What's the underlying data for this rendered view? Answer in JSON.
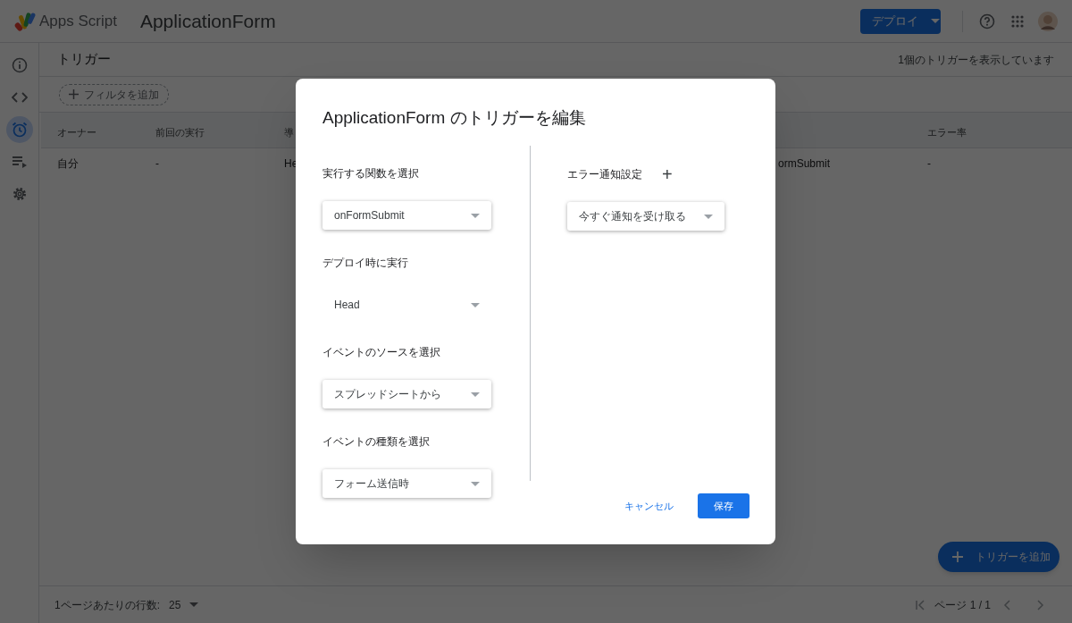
{
  "header": {
    "product": "Apps Script",
    "project": "ApplicationForm",
    "deploy_button": "デプロイ"
  },
  "sidebar": {
    "items": [
      {
        "selected": false
      },
      {
        "selected": false
      },
      {
        "selected": true
      },
      {
        "selected": false
      },
      {
        "selected": false
      }
    ]
  },
  "page": {
    "title": "トリガー",
    "count": "1個のトリガーを表示しています",
    "filter_button": "フィルタを追加"
  },
  "table": {
    "columns": [
      {
        "label": "オーナー"
      },
      {
        "label": "前回の実行"
      },
      {
        "label": "導"
      },
      {},
      {
        "label": "エラー率"
      }
    ],
    "rows": [
      {
        "cells": [
          "自分",
          "-",
          "He",
          "ormSubmit",
          "-"
        ]
      }
    ]
  },
  "dialog": {
    "title": "ApplicationForm のトリガーを編集",
    "left_fields": [
      {
        "label": "実行する関数を選択",
        "value": "onFormSubmit",
        "kind": "select"
      },
      {
        "label": "デプロイ時に実行",
        "value": "Head",
        "kind": "plain"
      },
      {
        "label": "イベントのソースを選択",
        "value": "スプレッドシートから",
        "kind": "select"
      },
      {
        "label": "イベントの種類を選択",
        "value": "フォーム送信時",
        "kind": "select"
      }
    ],
    "right_label": "エラー通知設定",
    "right_plus": "+",
    "right_field": {
      "value": "今すぐ通知を受け取る",
      "kind": "select"
    },
    "cancel_button": "キャンセル",
    "save_button": "保存"
  },
  "fab": {
    "label": "トリガーを追加"
  },
  "footer": {
    "rows_label": "1ページあたりの行数:",
    "rows_value": "25",
    "page": "ページ 1 / 1"
  }
}
